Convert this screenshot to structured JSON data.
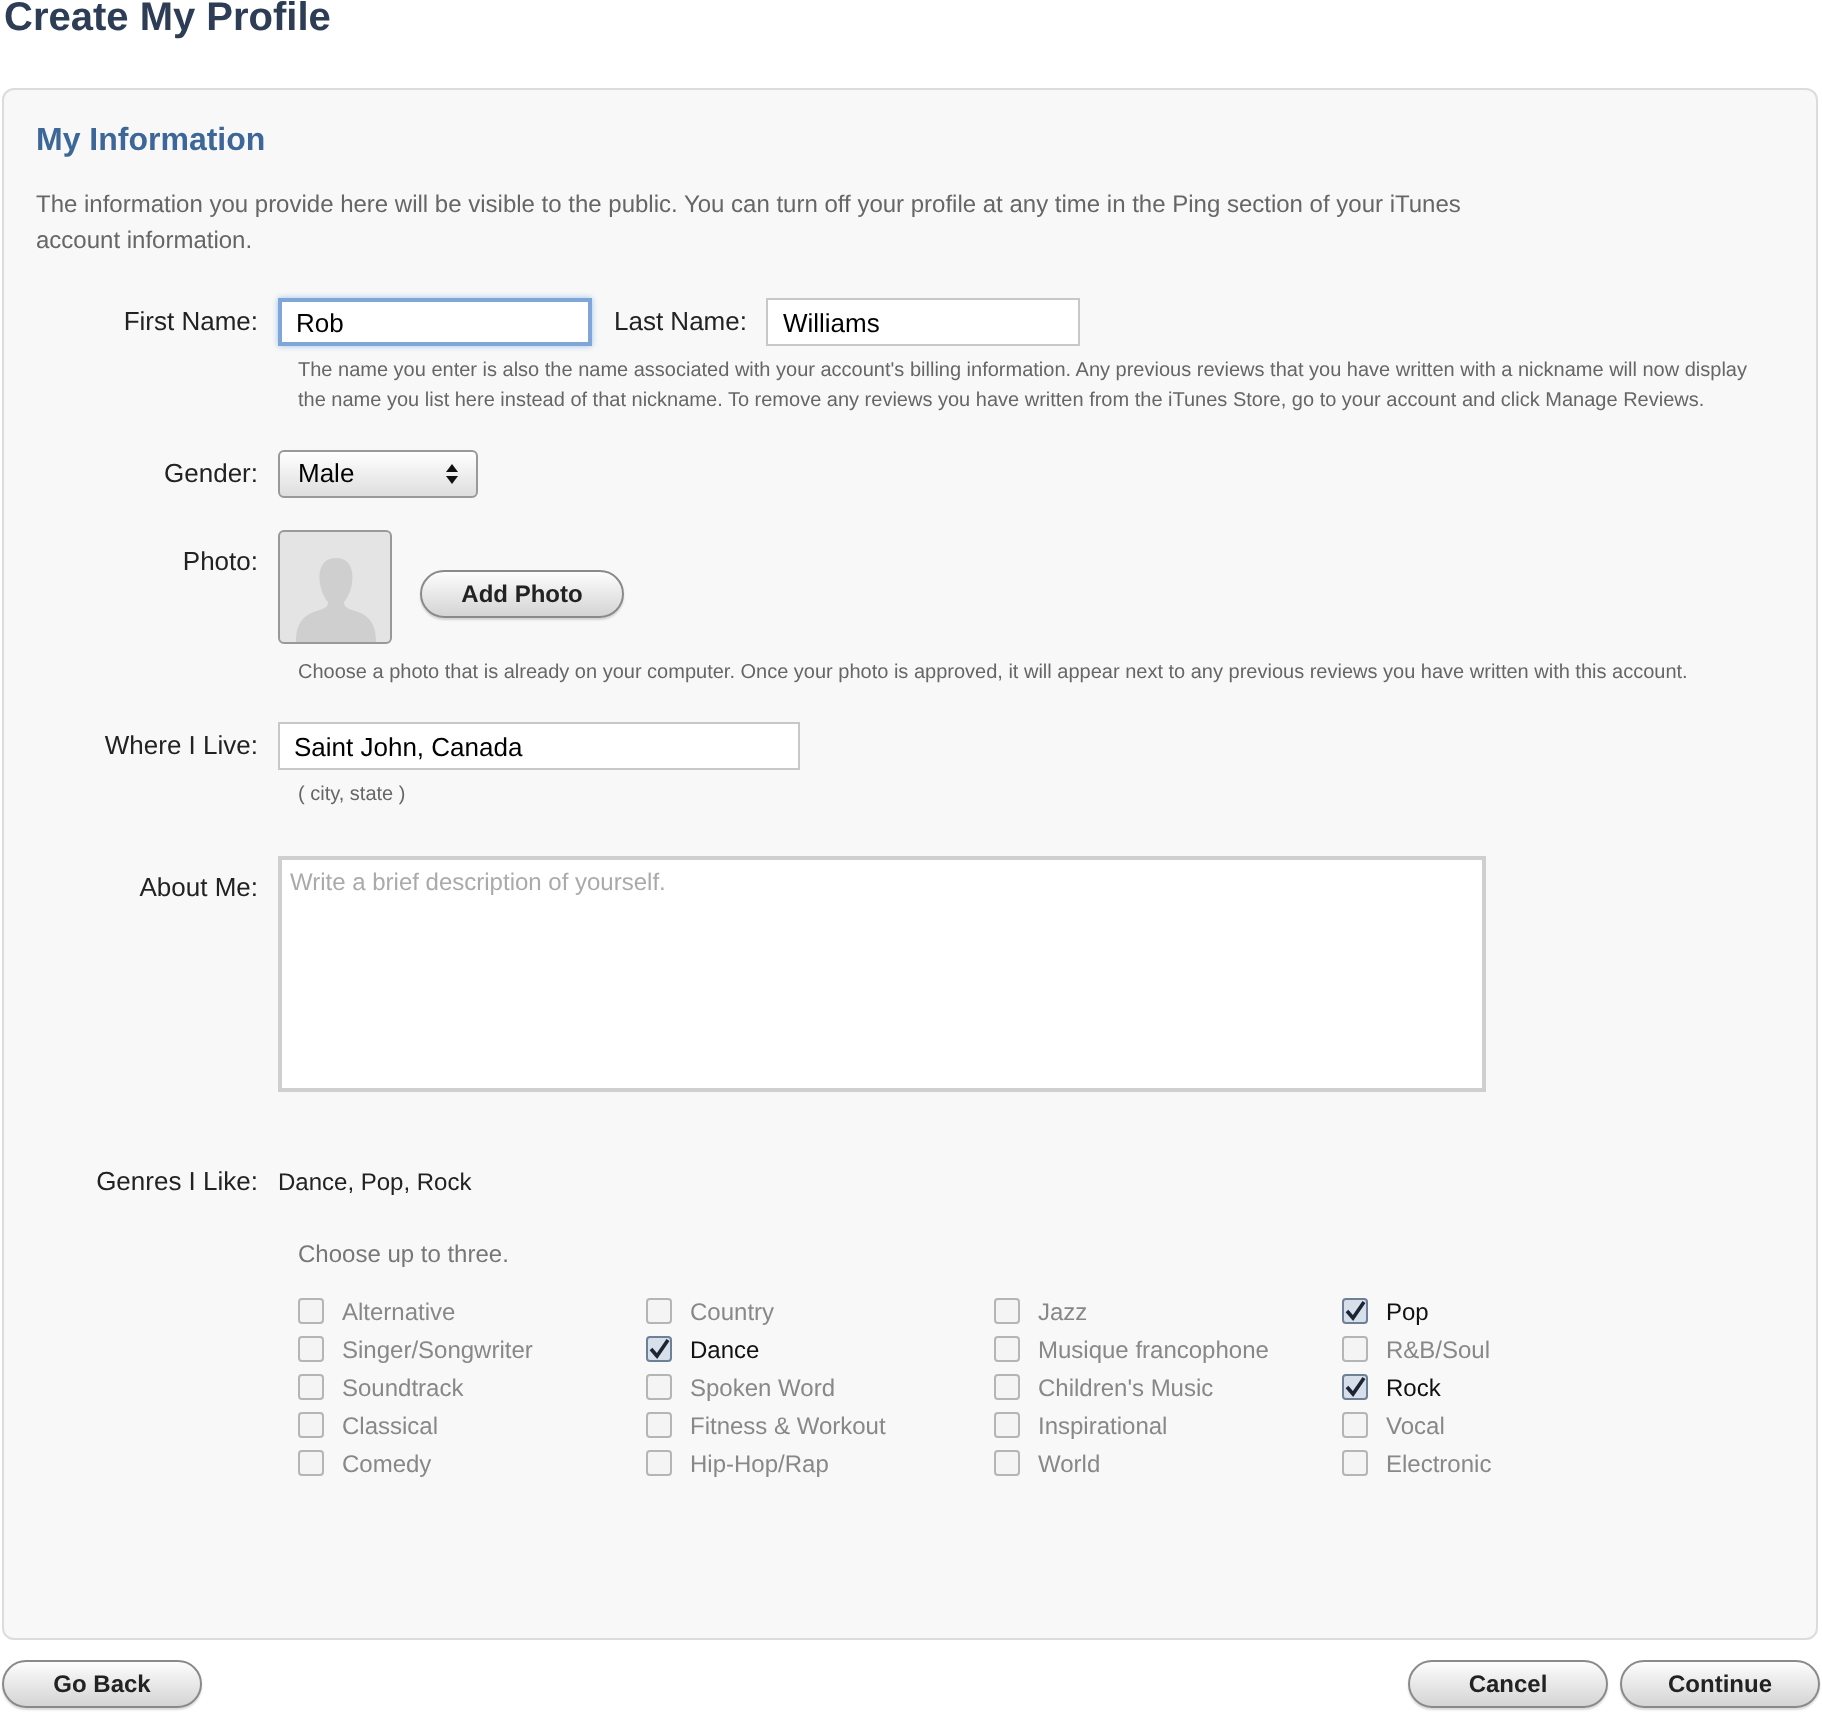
{
  "page_title": "Create My Profile",
  "section": {
    "title": "My Information",
    "intro": "The information you provide here will be visible to the public. You can turn off your profile at any time in the Ping section of your iTunes account information."
  },
  "first_name": {
    "label": "First Name:",
    "value": "Rob",
    "focused": true
  },
  "last_name": {
    "label": "Last Name:",
    "value": "Williams",
    "focused": false
  },
  "name_note": "The name you enter is also the name associated with your account's billing information. Any previous reviews that you have written with a nickname will now display the name you list here instead of that nickname. To remove any reviews you have written from the iTunes Store, go to your account and click Manage Reviews.",
  "gender": {
    "label": "Gender:",
    "value": "Male"
  },
  "photo": {
    "label": "Photo:",
    "button": "Add Photo",
    "note": "Choose a photo that is already on your computer. Once your photo is approved, it will appear next to any previous reviews you have written with this account."
  },
  "location": {
    "label": "Where I Live:",
    "value": "Saint John, Canada",
    "focused": false,
    "hint": "( city, state )"
  },
  "about": {
    "label": "About Me:",
    "placeholder": "Write a brief description of yourself."
  },
  "genres": {
    "label": "Genres I Like:",
    "summary": "Dance, Pop, Rock",
    "hint": "Choose up to three.",
    "columns": [
      [
        {
          "label": "Alternative",
          "checked": false
        },
        {
          "label": "Singer/Songwriter",
          "checked": false
        },
        {
          "label": "Soundtrack",
          "checked": false
        },
        {
          "label": "Classical",
          "checked": false
        },
        {
          "label": "Comedy",
          "checked": false
        }
      ],
      [
        {
          "label": "Country",
          "checked": false
        },
        {
          "label": "Dance",
          "checked": true
        },
        {
          "label": "Spoken Word",
          "checked": false
        },
        {
          "label": "Fitness & Workout",
          "checked": false
        },
        {
          "label": "Hip-Hop/Rap",
          "checked": false
        }
      ],
      [
        {
          "label": "Jazz",
          "checked": false
        },
        {
          "label": "Musique francophone",
          "checked": false
        },
        {
          "label": "Children's Music",
          "checked": false
        },
        {
          "label": "Inspirational",
          "checked": false
        },
        {
          "label": "World",
          "checked": false
        }
      ],
      [
        {
          "label": "Pop",
          "checked": true
        },
        {
          "label": "R&B/Soul",
          "checked": false
        },
        {
          "label": "Rock",
          "checked": true
        },
        {
          "label": "Vocal",
          "checked": false
        },
        {
          "label": "Electronic",
          "checked": false
        }
      ]
    ]
  },
  "buttons": {
    "back": "Go Back",
    "cancel": "Cancel",
    "continue": "Continue"
  }
}
